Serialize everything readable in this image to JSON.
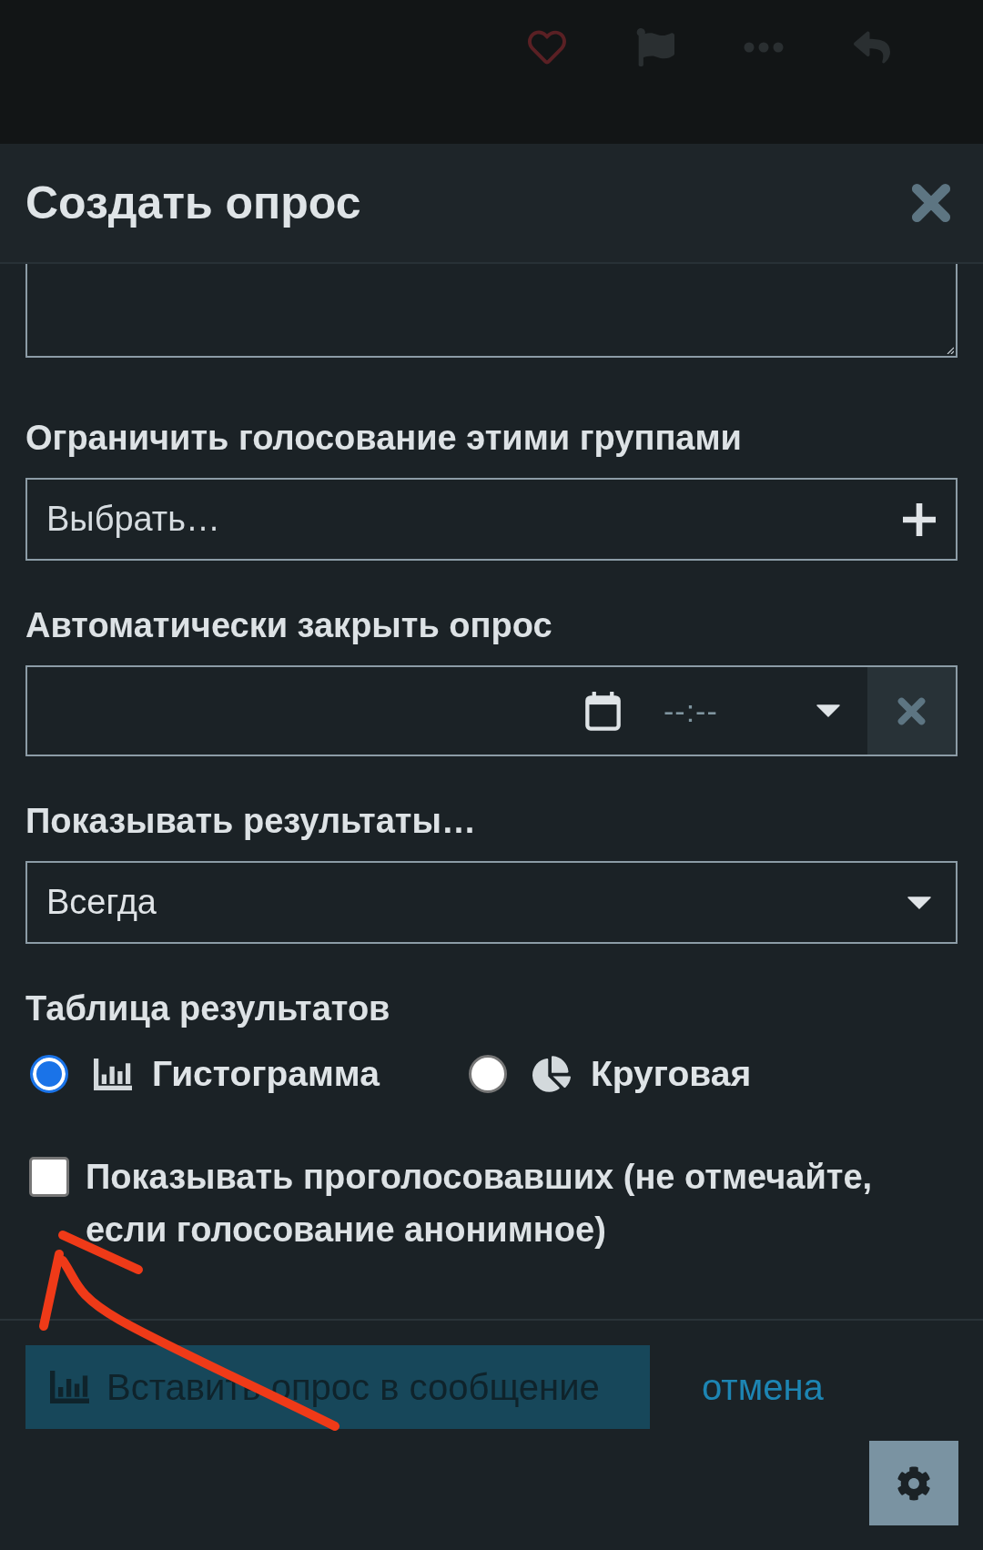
{
  "dialog": {
    "title": "Создать опрос"
  },
  "fields": [
    {
      "kind": "textarea"
    },
    {
      "kind": "multiselect",
      "label": "Ограничить голосование этими группами",
      "placeholder": "Выбрать…"
    },
    {
      "kind": "datetime",
      "label": "Автоматически закрыть опрос",
      "time": {
        "placeholder": "--:--"
      }
    },
    {
      "kind": "select",
      "label": "Показывать результаты…",
      "value": "Всегда"
    },
    {
      "kind": "radio",
      "label": "Таблица результатов",
      "options": [
        {
          "kind": "bar",
          "label": "Гистограмма",
          "selected": true
        },
        {
          "kind": "pie",
          "label": "Круговая",
          "selected": false
        }
      ]
    },
    {
      "kind": "checkbox",
      "label": "Показывать проголосовавших (не отмечайте, если голосование анонимное)",
      "checked": false
    }
  ],
  "actions": {
    "submit": {
      "label": "Вставить опрос в сообщение",
      "disabled": true
    },
    "cancel": {
      "label": "отмена"
    }
  }
}
